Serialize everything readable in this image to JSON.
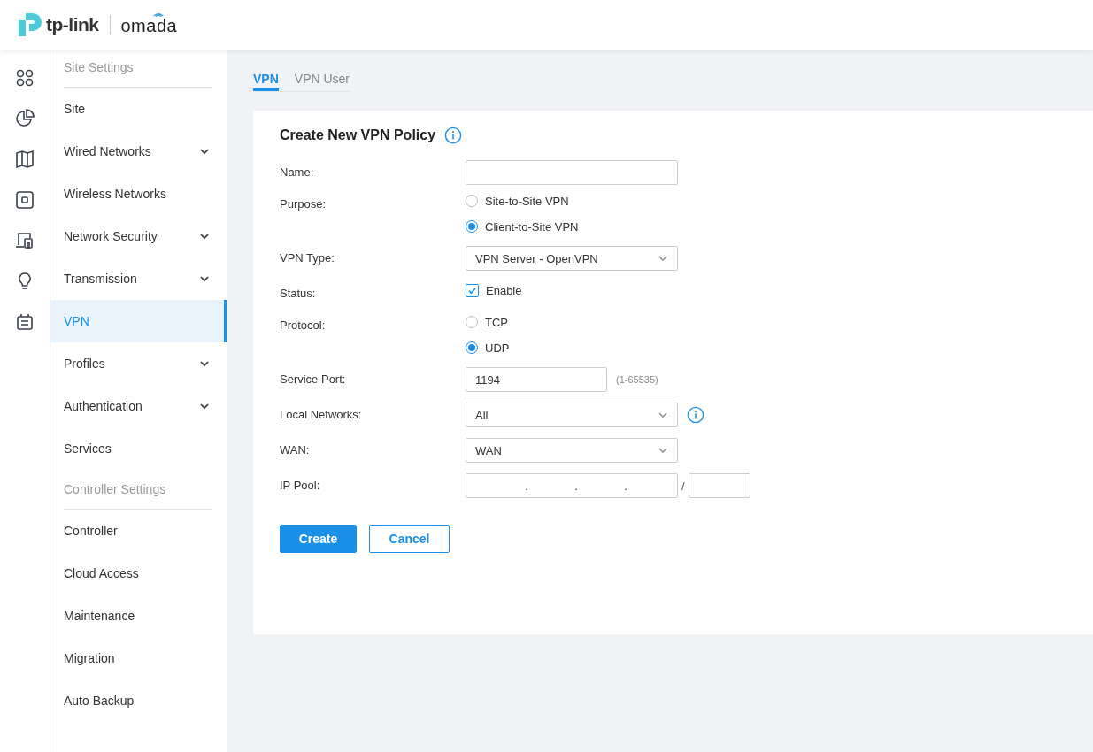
{
  "header": {
    "brand": "tp-link",
    "product": "omada"
  },
  "sidebar": {
    "sections": [
      {
        "title": "Site Settings",
        "items": [
          {
            "label": "Site",
            "has_submenu": false,
            "selected": false
          },
          {
            "label": "Wired Networks",
            "has_submenu": true,
            "selected": false
          },
          {
            "label": "Wireless Networks",
            "has_submenu": false,
            "selected": false
          },
          {
            "label": "Network Security",
            "has_submenu": true,
            "selected": false
          },
          {
            "label": "Transmission",
            "has_submenu": true,
            "selected": false
          },
          {
            "label": "VPN",
            "has_submenu": false,
            "selected": true
          },
          {
            "label": "Profiles",
            "has_submenu": true,
            "selected": false
          },
          {
            "label": "Authentication",
            "has_submenu": true,
            "selected": false
          },
          {
            "label": "Services",
            "has_submenu": false,
            "selected": false
          }
        ]
      },
      {
        "title": "Controller Settings",
        "items": [
          {
            "label": "Controller",
            "has_submenu": false,
            "selected": false
          },
          {
            "label": "Cloud Access",
            "has_submenu": false,
            "selected": false
          },
          {
            "label": "Maintenance",
            "has_submenu": false,
            "selected": false
          },
          {
            "label": "Migration",
            "has_submenu": false,
            "selected": false
          },
          {
            "label": "Auto Backup",
            "has_submenu": false,
            "selected": false
          }
        ]
      }
    ]
  },
  "tabs": [
    {
      "label": "VPN",
      "selected": true
    },
    {
      "label": "VPN User",
      "selected": false
    }
  ],
  "form": {
    "title": "Create New VPN Policy",
    "fields": [
      {
        "kind": "text",
        "label": "Name:"
      },
      {
        "kind": "radio",
        "label": "Purpose:",
        "options": [
          {
            "label": "Site-to-Site VPN",
            "selected": false
          },
          {
            "label": "Client-to-Site VPN",
            "selected": true
          }
        ]
      },
      {
        "kind": "select",
        "label": "VPN Type:",
        "value": "VPN Server - OpenVPN"
      },
      {
        "kind": "checkbox",
        "label": "Status:",
        "option": "Enable",
        "checked": true
      },
      {
        "kind": "radio",
        "label": "Protocol:",
        "options": [
          {
            "label": "TCP",
            "selected": false
          },
          {
            "label": "UDP",
            "selected": true
          }
        ]
      },
      {
        "kind": "port",
        "label": "Service Port:",
        "value": "1194",
        "hint": "(1-65535)"
      },
      {
        "kind": "select",
        "label": "Local Networks:",
        "value": "All",
        "info": true
      },
      {
        "kind": "select",
        "label": "WAN:",
        "value": "WAN"
      },
      {
        "kind": "ip",
        "label": "IP Pool:",
        "dots": [
          ".",
          ".",
          "."
        ],
        "mask_separator": "/"
      }
    ],
    "buttons": [
      {
        "label": "Create",
        "kind": "primary"
      },
      {
        "label": "Cancel",
        "kind": "secondary"
      }
    ]
  }
}
